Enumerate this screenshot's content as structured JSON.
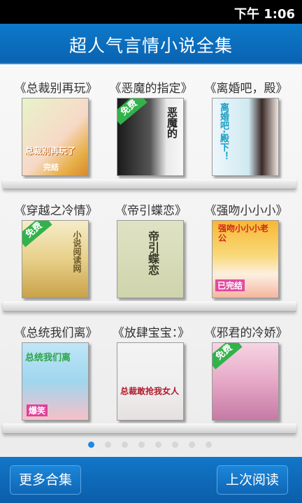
{
  "statusbar": {
    "time": "下午 1:06"
  },
  "header": {
    "title": "超人气言情小说全集"
  },
  "books": [
    {
      "title": "《总裁别再玩》",
      "cover_text": "总裁别再玩了",
      "cover_sub": "完结",
      "badge": ""
    },
    {
      "title": "《恶魔的指定》",
      "cover_text": "恶魔的",
      "cover_sub": "",
      "badge": "免费"
    },
    {
      "title": "《离婚吧，殿》",
      "cover_text": "离婚吧·殿下！",
      "cover_sub": "",
      "badge": ""
    },
    {
      "title": "《穿越之冷情》",
      "cover_text": "小说阅读网",
      "cover_sub": "",
      "badge": "免费"
    },
    {
      "title": "《帝引蝶恋》",
      "cover_text": "帝引蝶恋",
      "cover_sub": "",
      "badge": ""
    },
    {
      "title": "《强吻小小小》",
      "cover_text": "强吻小小小老公",
      "cover_sub": "已完结",
      "badge": ""
    },
    {
      "title": "《总统我们离》",
      "cover_text": "总统我们离",
      "cover_sub": "爆笑",
      "badge": ""
    },
    {
      "title": "《放肆宝宝：》",
      "cover_text": "总裁敢抢我女人",
      "cover_sub": "",
      "badge": ""
    },
    {
      "title": "《邪君的冷娇》",
      "cover_text": "",
      "cover_sub": "",
      "badge": "免费"
    }
  ],
  "pager": {
    "count": 8,
    "active_index": 0
  },
  "buttons": {
    "more": "更多合集",
    "last": "上次阅读"
  },
  "colors": {
    "header": "#0a63b2",
    "accent": "#1e88e5",
    "badge": "#32b24b"
  }
}
